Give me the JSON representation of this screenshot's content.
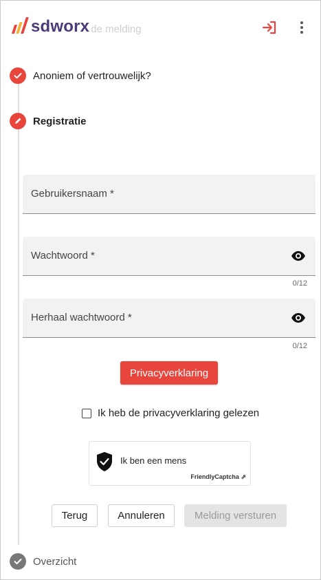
{
  "header": {
    "brand": "sdworx",
    "behind_title": "de melding",
    "icons": {
      "login": "login-arrow-icon",
      "more": "more-vertical-icon"
    },
    "colors": {
      "accent": "#e8453c",
      "brand_text": "#4a3a78",
      "brand_yellow": "#f3b23a"
    }
  },
  "steps": [
    {
      "label": "Anoniem of vertrouwelijk?",
      "icon": "check-icon",
      "state": "done"
    },
    {
      "label": "Registratie",
      "icon": "pencil-icon",
      "state": "active"
    },
    {
      "label": "Overzicht",
      "icon": "check-icon",
      "state": "pending"
    }
  ],
  "form": {
    "username": {
      "label": "Gebruikersnaam *",
      "value": ""
    },
    "password": {
      "label": "Wachtwoord *",
      "value": "",
      "counter": "0/12",
      "icon": "eye-icon"
    },
    "password_repeat": {
      "label": "Herhaal wachtwoord *",
      "value": "",
      "counter": "0/12",
      "icon": "eye-icon"
    },
    "privacy_button": "Privacyverklaring",
    "privacy_checkbox": {
      "label": "Ik heb de privacyverklaring gelezen",
      "checked": false
    }
  },
  "captcha": {
    "text": "Ik ben een mens",
    "brand": "FriendlyCaptcha",
    "icon": "shield-check-icon"
  },
  "actions": {
    "back": "Terug",
    "cancel": "Annuleren",
    "submit": "Melding versturen",
    "submit_disabled": true
  }
}
